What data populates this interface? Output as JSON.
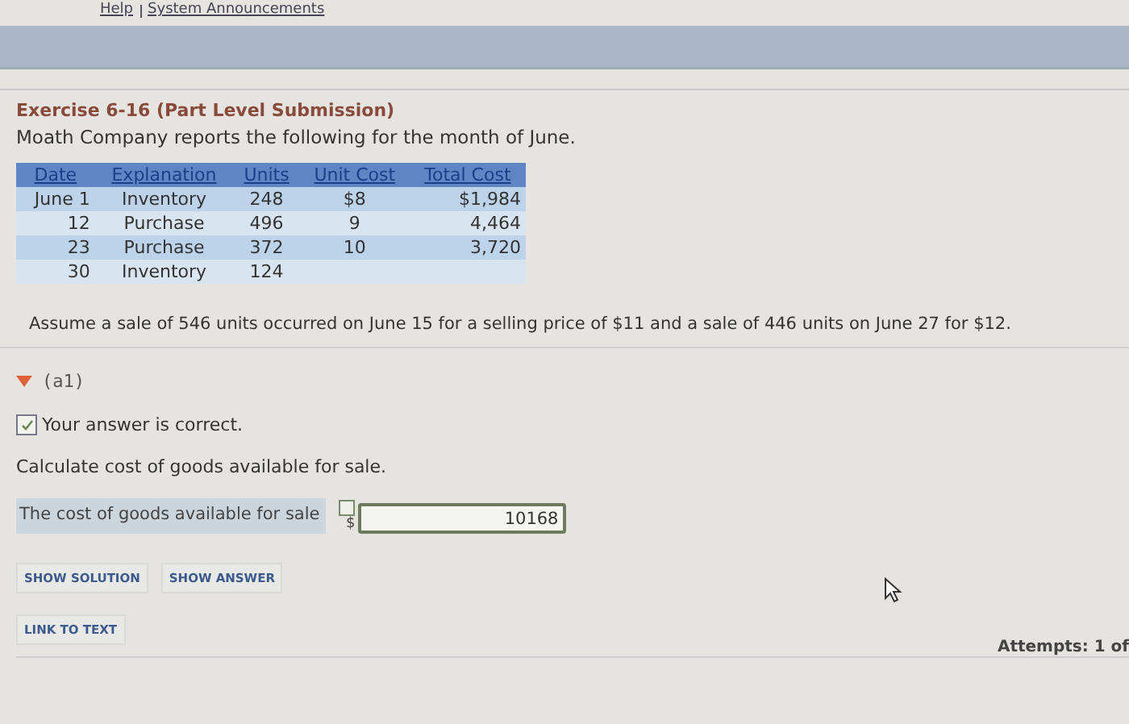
{
  "top_links": [
    "Help",
    "System Announcements"
  ],
  "exercise": {
    "title": "Exercise 6-16 (Part Level Submission)",
    "intro": "Moath Company reports the following for the month of June."
  },
  "table": {
    "columns": [
      "Date",
      "Explanation",
      "Units",
      "Unit Cost",
      "Total Cost"
    ],
    "rows": [
      [
        "June 1",
        "Inventory",
        "248",
        "$8",
        "$1,984"
      ],
      [
        "12",
        "Purchase",
        "496",
        "9",
        "4,464"
      ],
      [
        "23",
        "Purchase",
        "372",
        "10",
        "3,720"
      ],
      [
        "30",
        "Inventory",
        "124",
        "",
        ""
      ]
    ]
  },
  "assumption": "Assume a sale of 546 units occurred on June 15 for a selling price of $11 and a sale of 446 units on June 27 for $12.",
  "part": {
    "label": "(a1)",
    "expanded": true,
    "feedback": "Your answer is correct.",
    "correct": true,
    "question": "Calculate cost of goods available for sale.",
    "field_label": "The cost of goods available for sale",
    "currency": "$",
    "value": "10168",
    "buttons": [
      "SHOW SOLUTION",
      "SHOW ANSWER"
    ],
    "link": "LINK TO TEXT"
  },
  "attempts": "Attempts: 1 of"
}
